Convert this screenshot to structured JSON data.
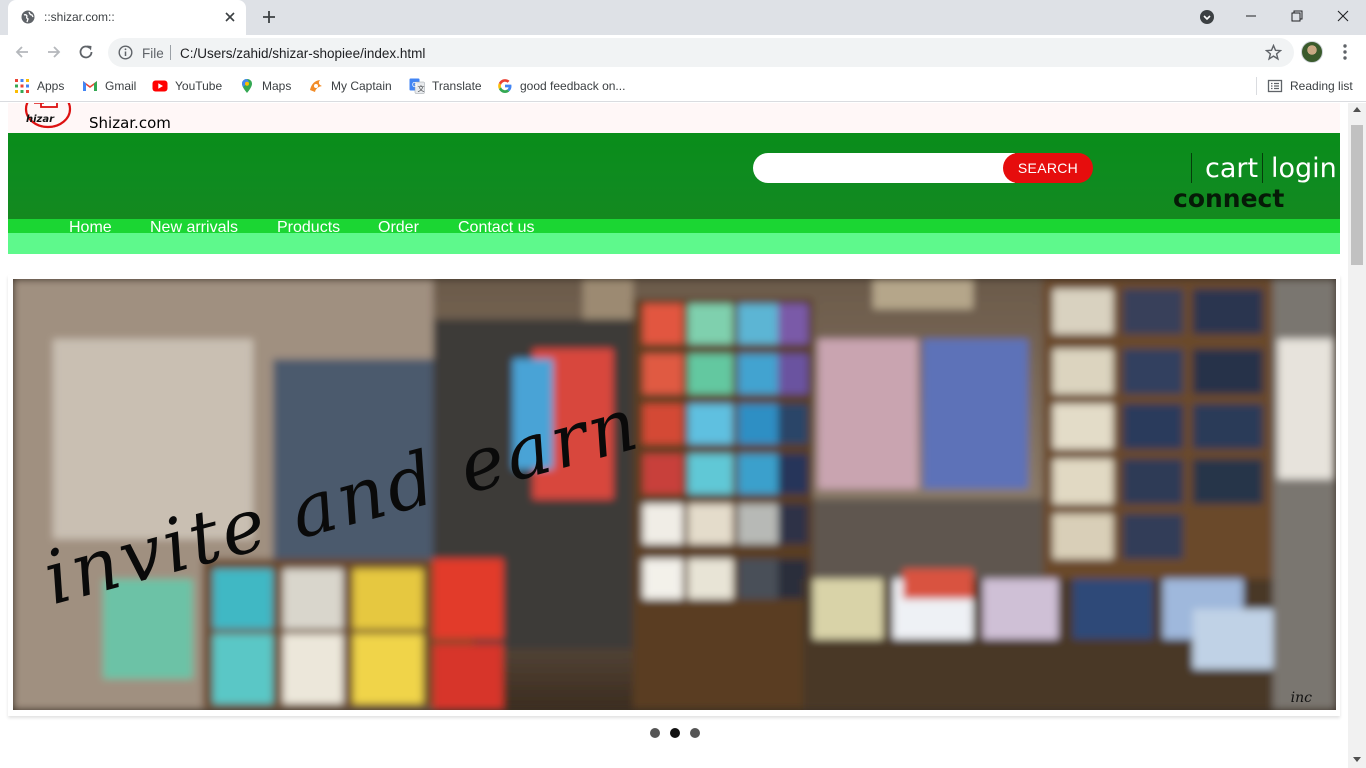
{
  "browser": {
    "tab_title": "::shizar.com::",
    "url_scheme": "File",
    "url": "C:/Users/zahid/shizar-shopiee/index.html",
    "bookmarks": [
      {
        "label": "Apps",
        "icon": "apps-grid-icon"
      },
      {
        "label": "Gmail",
        "icon": "gmail-icon"
      },
      {
        "label": "YouTube",
        "icon": "youtube-icon"
      },
      {
        "label": "Maps",
        "icon": "maps-icon"
      },
      {
        "label": "My Captain",
        "icon": "mycaptain-icon"
      },
      {
        "label": "Translate",
        "icon": "translate-icon"
      },
      {
        "label": "good feedback on...",
        "icon": "google-icon"
      }
    ],
    "reading_list": "Reading list"
  },
  "site": {
    "logo_text": "hizar",
    "name": "Shizar.com",
    "search_placeholder": "",
    "search_button": "SEARCH",
    "cart": "cart",
    "login": "login",
    "connect": "connect",
    "nav": [
      "Home",
      "New arrivals",
      "Products",
      "Order",
      "Contact us"
    ],
    "banner": {
      "headline": "invite and earn",
      "signature": "inc",
      "slides": 3,
      "active_slide": 2
    },
    "colors": {
      "header_green": "#0f8b20",
      "nav_green": "#1bd633",
      "nav_band": "#5ef98c",
      "search_button": "#e60d0d"
    }
  }
}
